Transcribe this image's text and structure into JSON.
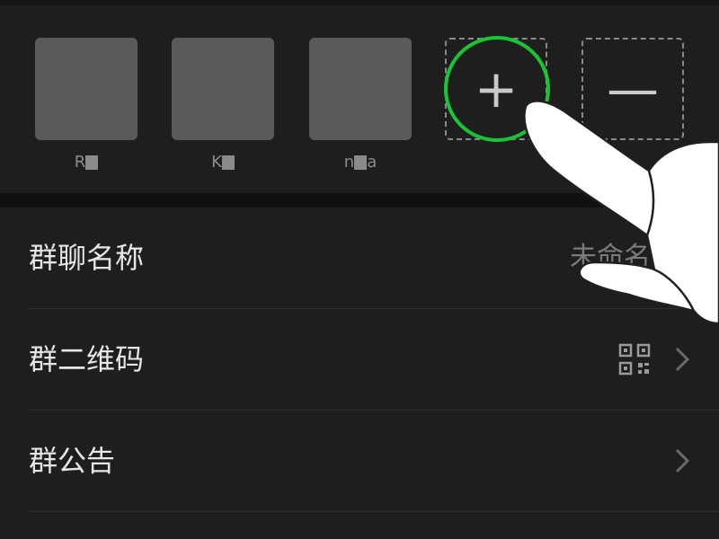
{
  "members": [
    {
      "name_prefix": "R",
      "name_suffix": ""
    },
    {
      "name_prefix": "K",
      "name_suffix": ""
    },
    {
      "name_prefix": "n",
      "name_suffix": "a"
    }
  ],
  "actions": {
    "add_glyph": "+",
    "remove_glyph": "—"
  },
  "settings": {
    "group_name": {
      "label": "群聊名称",
      "value": "未命名"
    },
    "group_qr": {
      "label": "群二维码"
    },
    "group_notice": {
      "label": "群公告"
    }
  },
  "colors": {
    "background": "#111111",
    "panel": "#1e1e1e",
    "avatar": "#5a5a5a",
    "highlight": "#19c537",
    "label_text": "#e6e6e6",
    "muted_text": "#7b7b7b"
  }
}
